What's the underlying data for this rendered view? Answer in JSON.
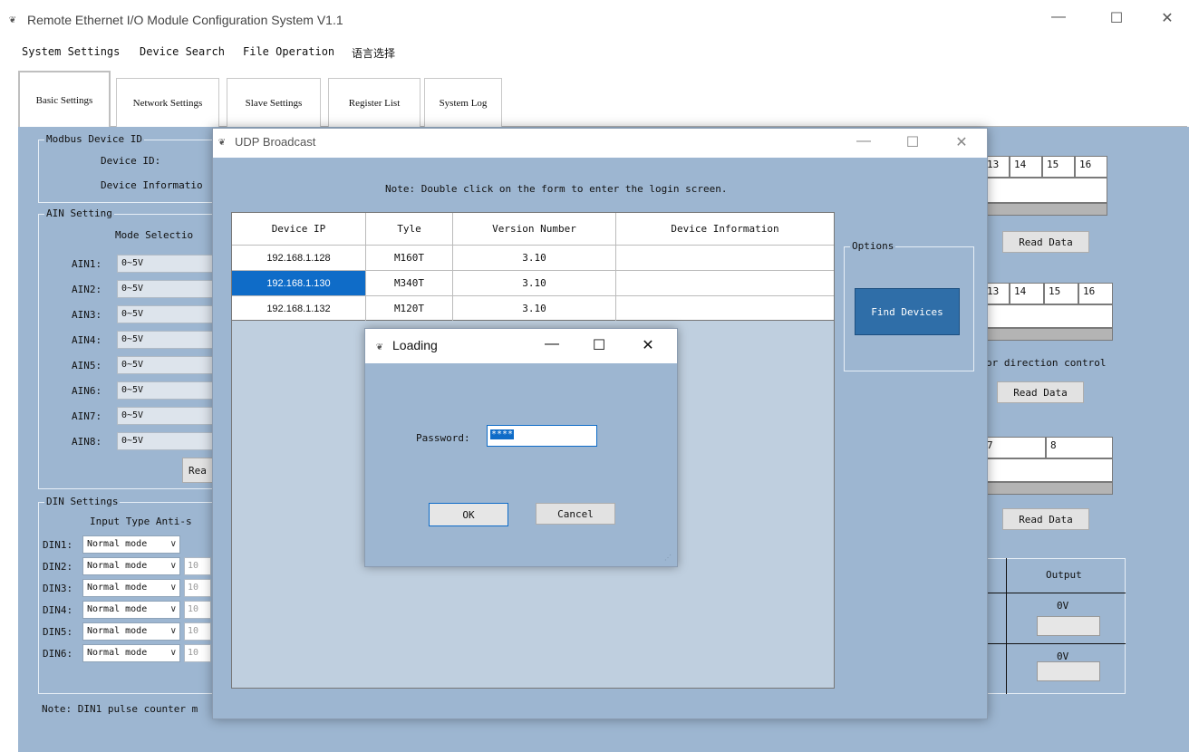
{
  "main_window": {
    "title": "Remote Ethernet I/O Module Configuration System V1.1",
    "controls": {
      "minimize": "—",
      "maximize": "☐",
      "close": "✕"
    }
  },
  "menu": [
    "System Settings",
    "Device Search",
    "File Operation",
    "语言选择"
  ],
  "tabs": [
    "Basic Settings",
    "Network Settings",
    "Slave Settings",
    "Register List",
    "System Log"
  ],
  "left_panel": {
    "modbus_group": "Modbus Device ID",
    "device_id_label": "Device ID:",
    "device_info_label": "Device Informatio",
    "ain_group": "AIN Setting",
    "mode_selection_label": "Mode Selectio",
    "ain_rows": [
      {
        "label": "AIN1:",
        "value": "0~5V"
      },
      {
        "label": "AIN2:",
        "value": "0~5V"
      },
      {
        "label": "AIN3:",
        "value": "0~5V"
      },
      {
        "label": "AIN4:",
        "value": "0~5V"
      },
      {
        "label": "AIN5:",
        "value": "0~5V"
      },
      {
        "label": "AIN6:",
        "value": "0~5V"
      },
      {
        "label": "AIN7:",
        "value": "0~5V"
      },
      {
        "label": "AIN8:",
        "value": "0~5V"
      }
    ],
    "read_button_partial": "Rea",
    "din_group": "DIN Settings",
    "din_header": "Input Type  Anti-s",
    "din_rows": [
      {
        "label": "DIN1:",
        "mode": "Normal mode",
        "value": ""
      },
      {
        "label": "DIN2:",
        "mode": "Normal mode",
        "value": "10"
      },
      {
        "label": "DIN3:",
        "mode": "Normal mode",
        "value": "10"
      },
      {
        "label": "DIN4:",
        "mode": "Normal mode",
        "value": "10"
      },
      {
        "label": "DIN5:",
        "mode": "Normal mode",
        "value": "10"
      },
      {
        "label": "DIN6:",
        "mode": "Normal mode",
        "value": "10"
      }
    ],
    "note": "Note: DIN1 pulse counter m"
  },
  "right_panel": {
    "grid1_headers": [
      "13",
      "14",
      "15",
      "16"
    ],
    "grid2_headers": [
      "13",
      "14",
      "15",
      "16"
    ],
    "grid3_headers": [
      "7",
      "8"
    ],
    "read_data_label": "Read Data",
    "direction_text": "or direction control",
    "output_header": "Output",
    "output_rows": [
      "0V",
      "0V"
    ]
  },
  "udp_window": {
    "title": "UDP Broadcast",
    "note": "Note: Double click on the form to enter the login screen.",
    "columns": [
      "Device IP",
      "Tyle",
      "Version Number",
      "Device Information"
    ],
    "rows": [
      {
        "ip": "192.168.1.128",
        "type": "M160T",
        "version": "3.10",
        "info": ""
      },
      {
        "ip": "192.168.1.130",
        "type": "M340T",
        "version": "3.10",
        "info": ""
      },
      {
        "ip": "192.168.1.132",
        "type": "M120T",
        "version": "3.10",
        "info": ""
      }
    ],
    "selected_row": 1,
    "options_group": "Options",
    "find_devices": "Find Devices"
  },
  "loading_dialog": {
    "title": "Loading",
    "password_label": "Password:",
    "password_value": "****",
    "ok": "OK",
    "cancel": "Cancel"
  },
  "colors": {
    "panel_bg": "#9db6d1",
    "selection": "#0f6cc8",
    "find_button": "#2f6ea8"
  }
}
